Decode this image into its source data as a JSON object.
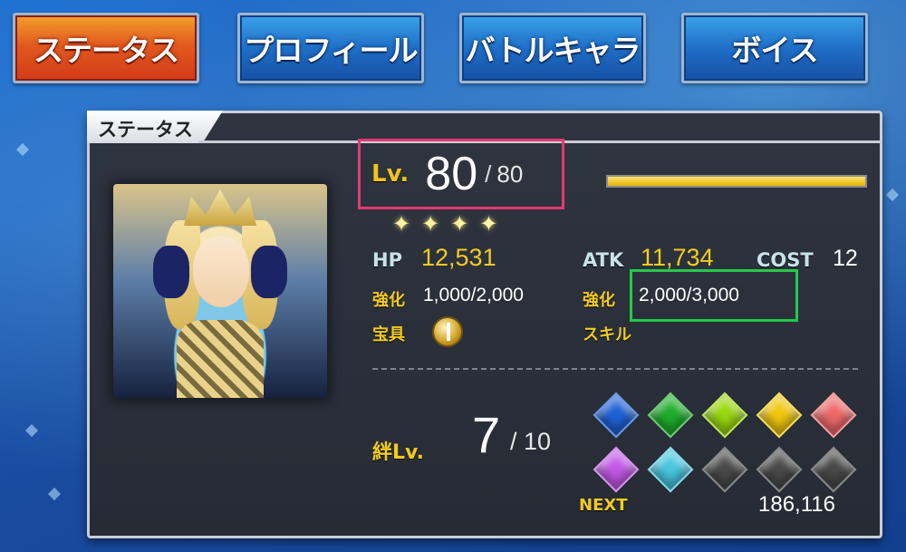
{
  "tabs": [
    {
      "label": "ステータス",
      "active": true
    },
    {
      "label": "プロフィール",
      "active": false
    },
    {
      "label": "バトルキャラ",
      "active": false
    },
    {
      "label": "ボイス",
      "active": false
    }
  ],
  "panel": {
    "title": "ステータス",
    "level": {
      "label": "Lv.",
      "value": "80",
      "max": "80",
      "exp_fill_fraction": 1.0
    },
    "rarity_stars": 4,
    "hp": {
      "label": "HP",
      "value": "12,531"
    },
    "atk": {
      "label": "ATK",
      "value": "11,734"
    },
    "cost": {
      "label": "COST",
      "value": "12"
    },
    "hp_fou": {
      "label": "強化",
      "value": "1,000",
      "max": "2,000"
    },
    "atk_fou": {
      "label": "強化",
      "value": "2,000",
      "max": "3,000"
    },
    "noble_phantasm_label": "宝具",
    "skill_label": "スキル",
    "bond": {
      "label": "絆Lv.",
      "value": "7",
      "max": "10"
    },
    "next_label": "NEXT",
    "next_value": "186,116",
    "colors": {
      "highlight_level": "#e53a72",
      "highlight_fou": "#25c94a",
      "accent_yellow": "#f3cb20"
    },
    "bond_gems": [
      {
        "color": "#1e62d8",
        "filled": true
      },
      {
        "color": "#1fae2a",
        "filled": true
      },
      {
        "color": "#9ad80e",
        "filled": true
      },
      {
        "color": "#f1c80f",
        "filled": true
      },
      {
        "color": "#ef6a6a",
        "filled": true
      },
      {
        "color": "#c45ae8",
        "filled": true
      },
      {
        "color": "#48c8e0",
        "filled": true
      },
      {
        "color": "#4a4a4a",
        "filled": false
      },
      {
        "color": "#4a4a4a",
        "filled": false
      },
      {
        "color": "#4a4a4a",
        "filled": false
      }
    ]
  }
}
